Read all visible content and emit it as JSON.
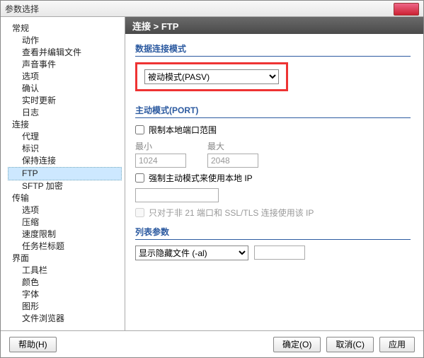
{
  "window": {
    "title": "参数选择"
  },
  "sidebar": {
    "items": [
      {
        "label": "常规",
        "lvl": 1
      },
      {
        "label": "动作",
        "lvl": 2
      },
      {
        "label": "查看并编辑文件",
        "lvl": 2
      },
      {
        "label": "声音事件",
        "lvl": 2
      },
      {
        "label": "选项",
        "lvl": 2
      },
      {
        "label": "确认",
        "lvl": 2
      },
      {
        "label": "实时更新",
        "lvl": 2
      },
      {
        "label": "日志",
        "lvl": 2
      },
      {
        "label": "连接",
        "lvl": 1
      },
      {
        "label": "代理",
        "lvl": 2
      },
      {
        "label": "标识",
        "lvl": 2
      },
      {
        "label": "保持连接",
        "lvl": 2
      },
      {
        "label": "FTP",
        "lvl": 2,
        "selected": true
      },
      {
        "label": "SFTP 加密",
        "lvl": 2
      },
      {
        "label": "传输",
        "lvl": 1
      },
      {
        "label": "选项",
        "lvl": 2
      },
      {
        "label": "压缩",
        "lvl": 2
      },
      {
        "label": "速度限制",
        "lvl": 2
      },
      {
        "label": "任务栏标题",
        "lvl": 2
      },
      {
        "label": "界面",
        "lvl": 1
      },
      {
        "label": "工具栏",
        "lvl": 2
      },
      {
        "label": "颜色",
        "lvl": 2
      },
      {
        "label": "字体",
        "lvl": 2
      },
      {
        "label": "图形",
        "lvl": 2
      },
      {
        "label": "文件浏览器",
        "lvl": 2
      }
    ]
  },
  "breadcrumb": "连接 > FTP",
  "sections": {
    "data_mode": {
      "title": "数据连接模式",
      "selected": "被动模式(PASV)"
    },
    "active_mode": {
      "title": "主动模式(PORT)",
      "limit_label": "限制本地端口范围",
      "min_label": "最小",
      "max_label": "最大",
      "min": "1024",
      "max": "2048",
      "force_label": "强制主动模式来使用本地 IP",
      "ssl_label": "只对于非 21 端口和 SSL/TLS 连接使用该 IP"
    },
    "list_params": {
      "title": "列表参数",
      "selected": "显示隐藏文件 (-al)"
    }
  },
  "footer": {
    "help": "帮助(H)",
    "ok": "确定(O)",
    "cancel": "取消(C)",
    "apply": "应用"
  }
}
